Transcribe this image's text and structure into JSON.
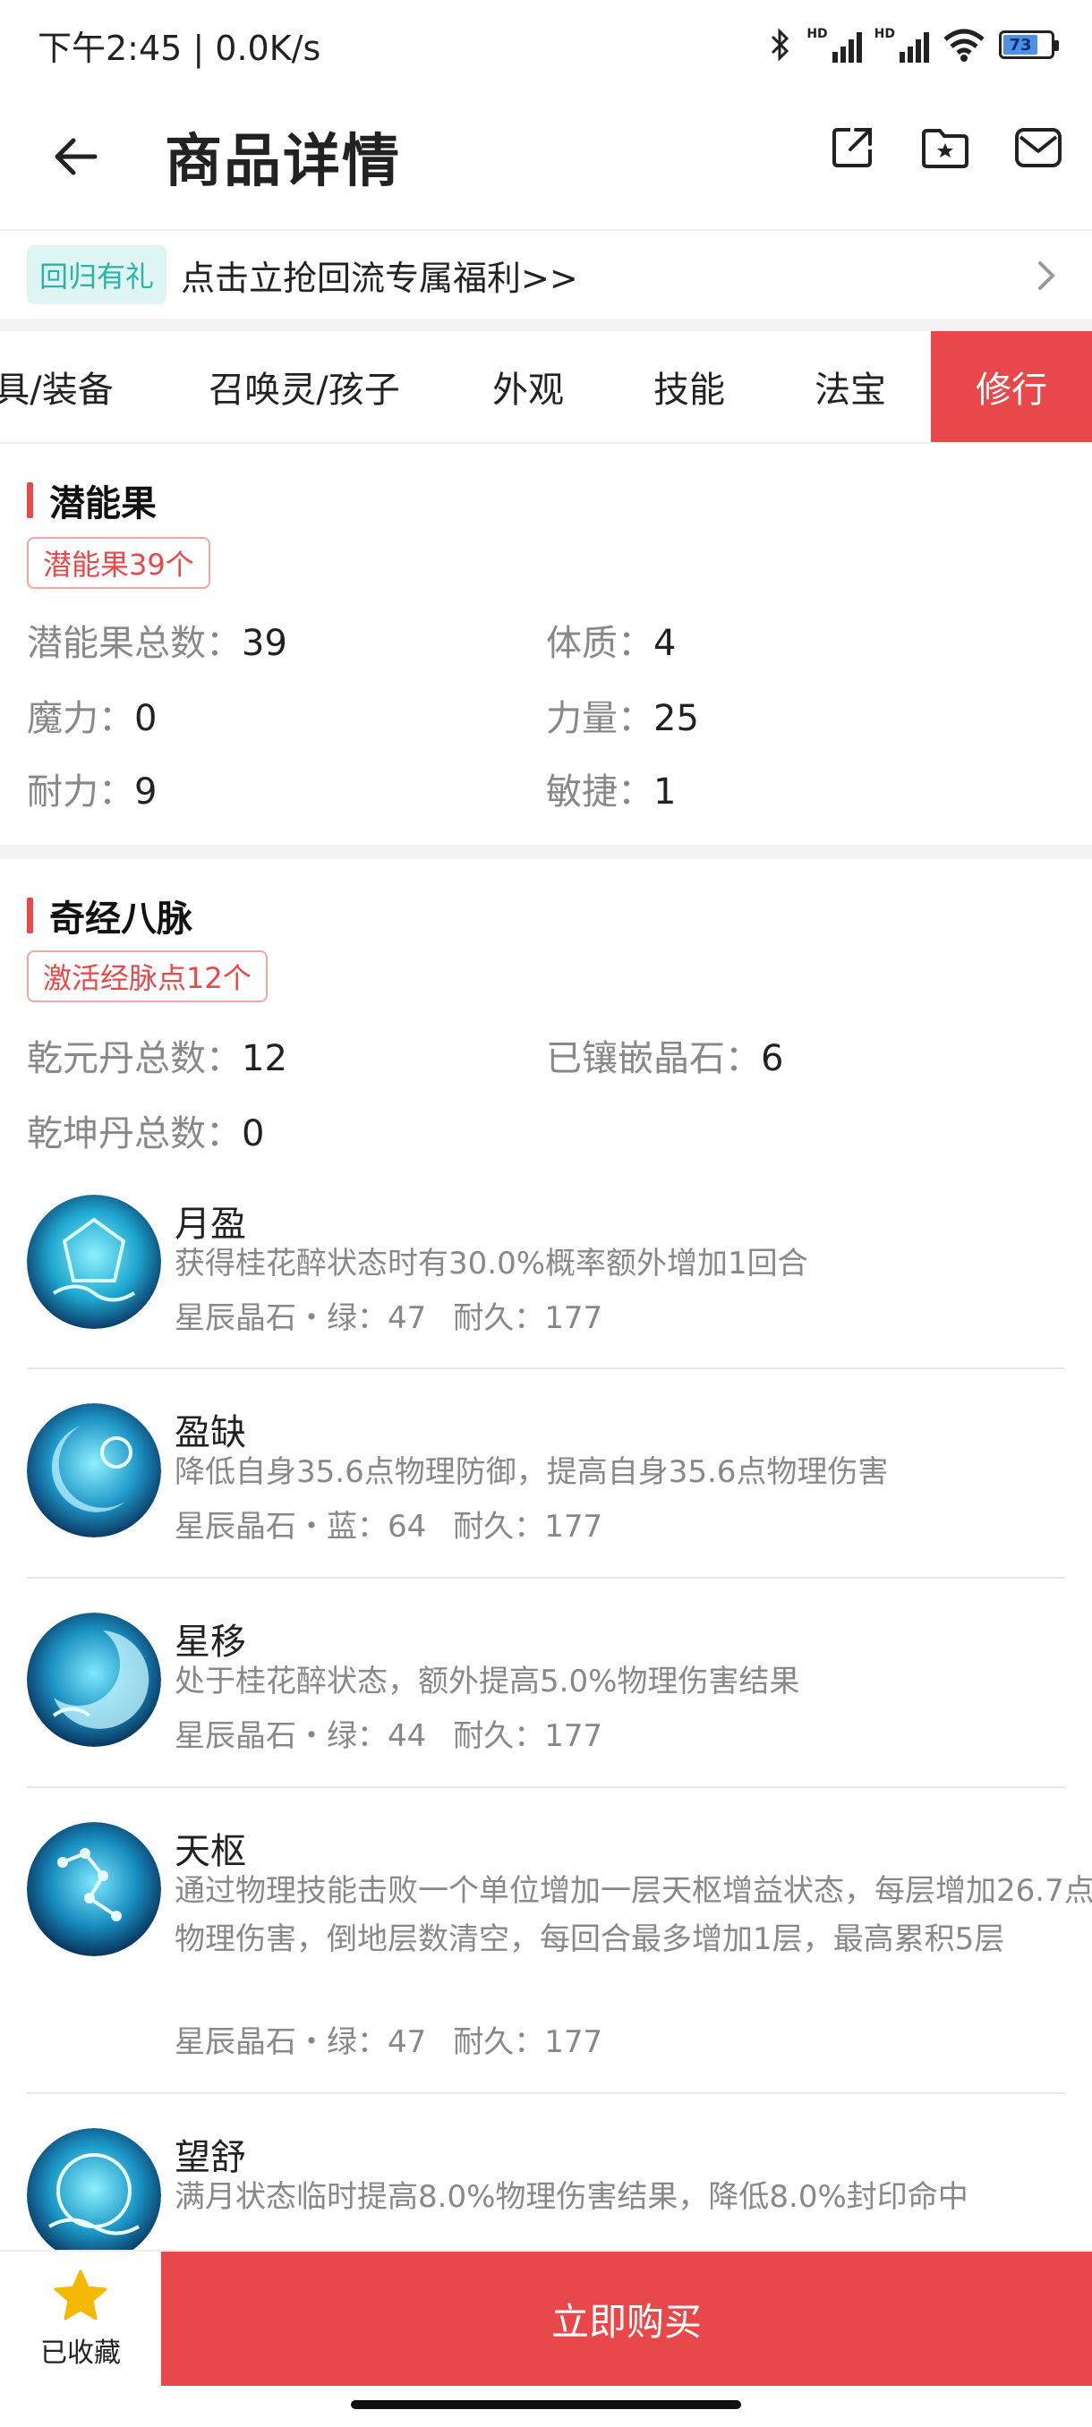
{
  "status_bar": {
    "time_speed": "下午2:45 | 0.0K/s",
    "battery": "73",
    "hd": "HD"
  },
  "header": {
    "title": "商品详情"
  },
  "promo": {
    "tag": "回归有礼",
    "text": "点击立抢回流专属福利>>"
  },
  "tabs": [
    {
      "label": "具/装备"
    },
    {
      "label": "召唤灵/孩子"
    },
    {
      "label": "外观"
    },
    {
      "label": "技能"
    },
    {
      "label": "法宝"
    },
    {
      "label": "修行",
      "active": true
    }
  ],
  "potential": {
    "title": "潜能果",
    "badge": "潜能果39个",
    "rows": [
      {
        "k": "潜能果总数：",
        "v": "39"
      },
      {
        "k": "体质：",
        "v": "4"
      },
      {
        "k": "魔力：",
        "v": "0"
      },
      {
        "k": "力量：",
        "v": "25"
      },
      {
        "k": "耐力：",
        "v": "9"
      },
      {
        "k": "敏捷：",
        "v": "1"
      }
    ]
  },
  "meridian": {
    "title": "奇经八脉",
    "badge": "激活经脉点12个",
    "rows": [
      {
        "k": "乾元丹总数：",
        "v": "12"
      },
      {
        "k": "已镶嵌晶石：",
        "v": "6"
      },
      {
        "k": "乾坤丹总数：",
        "v": "0"
      }
    ]
  },
  "gems": [
    {
      "name": "月盈",
      "desc": "获得桂花醉状态时有30.0%概率额外增加1回合",
      "meta1": "星辰晶石・绿：47",
      "meta2": "耐久：177"
    },
    {
      "name": "盈缺",
      "desc": "降低自身35.6点物理防御，提高自身35.6点物理伤害",
      "meta1": "星辰晶石・蓝：64",
      "meta2": "耐久：177"
    },
    {
      "name": "星移",
      "desc": "处于桂花醉状态，额外提高5.0%物理伤害结果",
      "meta1": "星辰晶石・绿：44",
      "meta2": "耐久：177"
    },
    {
      "name": "天枢",
      "desc": "通过物理技能击败一个单位增加一层天枢增益状态，每层增加26.7点物理伤害，倒地层数清空，每回合最多增加1层，最高累积5层",
      "meta1": "星辰晶石・绿：47",
      "meta2": "耐久：177"
    },
    {
      "name": "望舒",
      "desc": "满月状态临时提高8.0%物理伤害结果，降低8.0%封印命中",
      "meta1": "",
      "meta2": ""
    }
  ],
  "bottom": {
    "fav_label": "已收藏",
    "buy_label": "立即购买"
  },
  "colors": {
    "accent": "#e8484a",
    "teal": "#2ab3a6",
    "star": "#f5b800"
  }
}
